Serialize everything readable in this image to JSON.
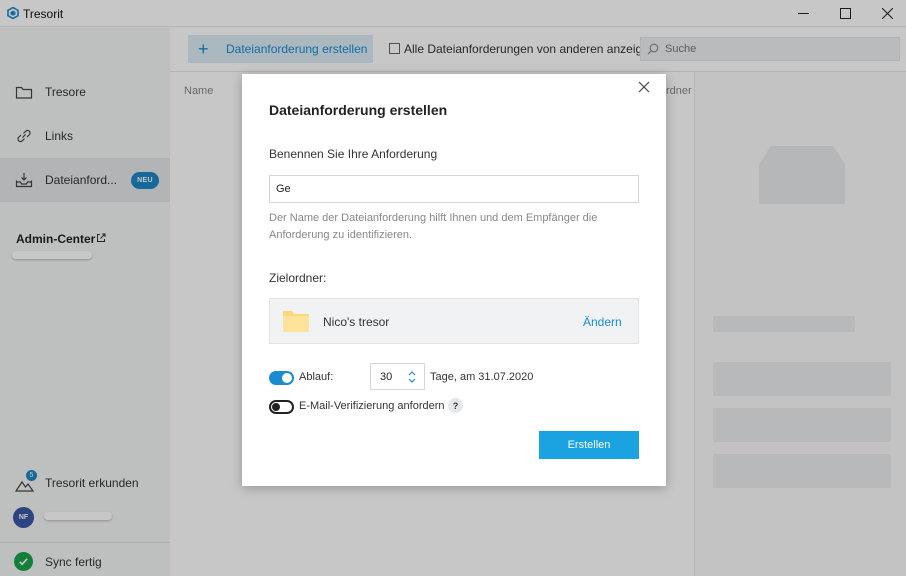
{
  "window": {
    "title": "Tresorit"
  },
  "sidebar": {
    "items": [
      {
        "label": "Tresore",
        "icon": "folder-icon"
      },
      {
        "label": "Links",
        "icon": "link-icon"
      },
      {
        "label": "Dateianford...",
        "icon": "inbox-icon",
        "badge": "NEU"
      }
    ],
    "admin_center": "Admin-Center",
    "explore": {
      "label": "Tresorit erkunden",
      "count": "5"
    },
    "user_initials": "NF",
    "sync_status": "Sync fertig"
  },
  "toolbar": {
    "create_label": "Dateianforderung erstellen",
    "show_others_label": "Alle Dateianforderungen von anderen anzeigen",
    "search_placeholder": "Suche"
  },
  "list": {
    "col_name": "Name",
    "col_right": "rdner"
  },
  "dialog": {
    "title": "Dateianforderung erstellen",
    "name_label": "Benennen Sie Ihre Anforderung",
    "name_value": "Ge",
    "hint": "Der Name der Dateianforderung hilft Ihnen und dem Empfänger die Anforderung zu identifizieren.",
    "target_label": "Zielordner:",
    "folder_name": "Nico's tresor",
    "change_label": "Ändern",
    "expiry_label": "Ablauf:",
    "expiry_enabled": true,
    "expiry_days": "30",
    "expiry_text": "Tage, am 31.07.2020",
    "verify_label": "E-Mail-Verifizierung anfordern",
    "verify_enabled": false,
    "help_label": "?",
    "submit_label": "Erstellen"
  },
  "colors": {
    "accent": "#1a8bd0",
    "submit": "#1aa3e0",
    "success": "#1aa349"
  }
}
